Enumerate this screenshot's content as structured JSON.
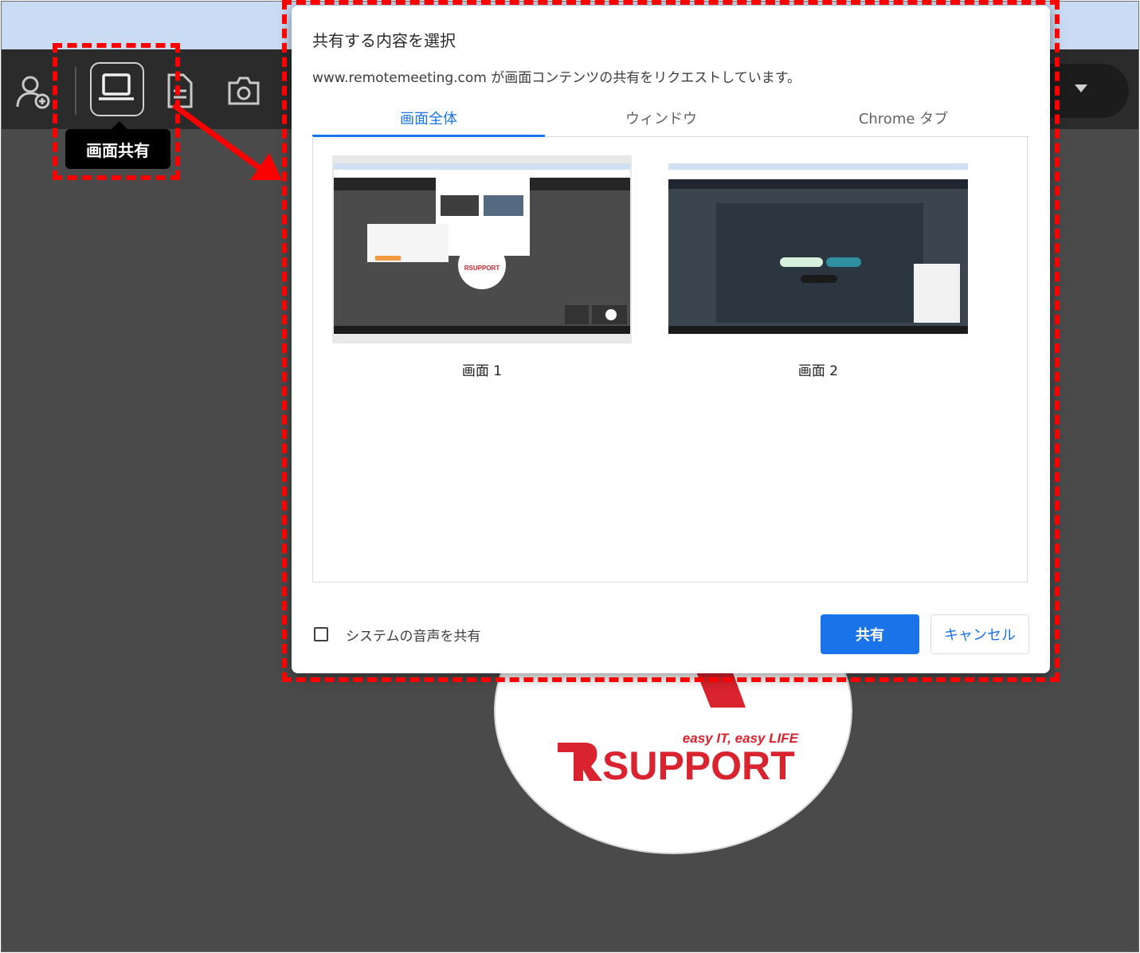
{
  "toolbar": {
    "tooltip": "画面共有"
  },
  "dialog": {
    "title": "共有する内容を選択",
    "subtitle": "www.remotemeeting.com が画面コンテンツの共有をリクエストしています。",
    "tabs": [
      {
        "label": "画面全体",
        "active": true
      },
      {
        "label": "ウィンドウ",
        "active": false
      },
      {
        "label": "Chrome タブ",
        "active": false
      }
    ],
    "screens": [
      {
        "label": "画面 1"
      },
      {
        "label": "画面 2"
      }
    ],
    "audio_checkbox_label": "システムの音声を共有",
    "audio_checked": false,
    "share_button": "共有",
    "cancel_button": "キャンセル"
  },
  "logo": {
    "tagline": "easy IT, easy LIFE",
    "brand": "SUPPORT"
  },
  "colors": {
    "accent": "#1a73e8",
    "highlight": "#ff0000",
    "toolbar_bg": "#2b2b2b",
    "stage_bg": "#4a4a4a",
    "brand_red": "#d9232e"
  }
}
